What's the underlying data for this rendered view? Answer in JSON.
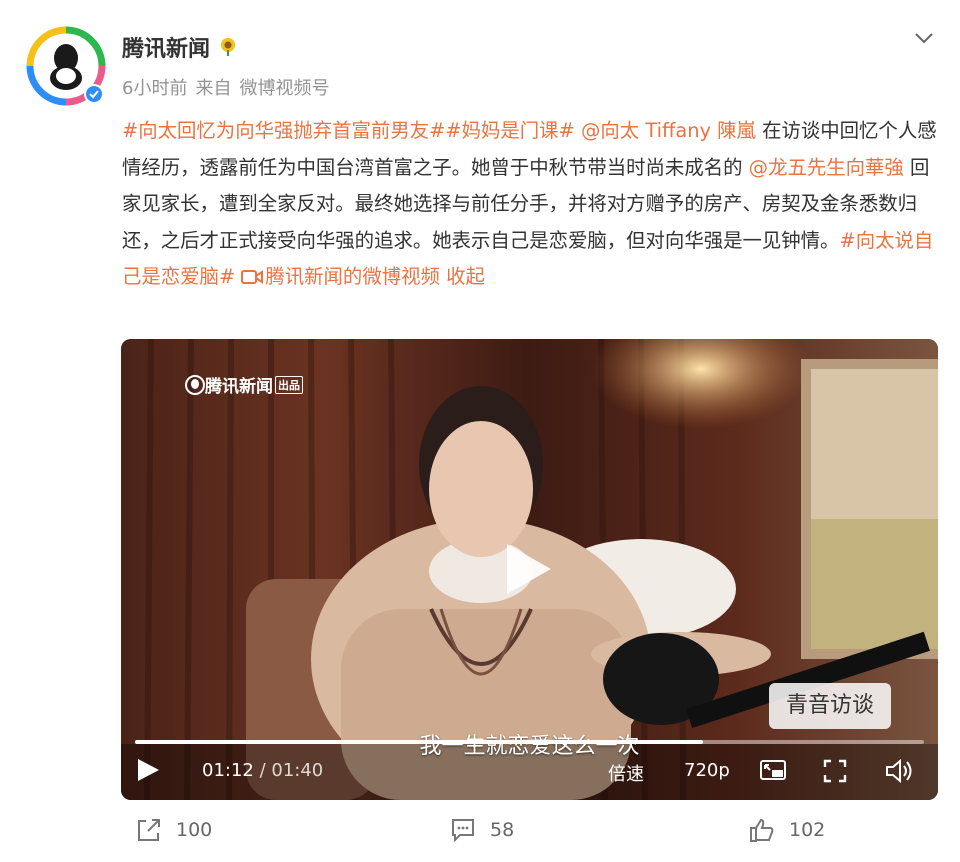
{
  "post": {
    "author": "腾讯新闻",
    "time": "6小时前",
    "source_prefix": "来自",
    "source": "微博视频号",
    "content": [
      {
        "type": "link",
        "text": "#向太回忆为向华强抛弃首富前男友#"
      },
      {
        "type": "link",
        "text": "#妈妈是门课#"
      },
      {
        "type": "text",
        "text": " "
      },
      {
        "type": "link",
        "text": "@向太 Tiffany 陳嵐"
      },
      {
        "type": "text",
        "text": " 在访谈中回忆个人感情经历，透露前任为中国台湾首富之子。她曾于中秋节带当时尚未成名的 "
      },
      {
        "type": "link",
        "text": "@龙五先生向華強"
      },
      {
        "type": "text",
        "text": " 回家见家长，遭到全家反对。最终她选择与前任分手，并将对方赠予的房产、房契及金条悉数归还，之后才正式接受向华强的追求。她表示自己是恋爱脑，但对向华强是一见钟情。"
      },
      {
        "type": "link",
        "text": "#向太说自己是恋爱脑#"
      },
      {
        "type": "text",
        "text": " "
      },
      {
        "type": "video-link",
        "text": "腾讯新闻的微博视频",
        "icon": "video-camera-icon"
      },
      {
        "type": "text",
        "text": " "
      },
      {
        "type": "link",
        "text": "收起"
      }
    ]
  },
  "video": {
    "watermark": "腾讯新闻",
    "watermark_badge": "出品",
    "show_name": "青音访谈",
    "subtitle": "我一生就恋爱这么一次",
    "current_time": "01:12",
    "separator": " / ",
    "duration": "01:40",
    "progress": 0.72,
    "speed_label": "倍速",
    "quality_label": "720p"
  },
  "actions": {
    "repost_count": "100",
    "comment_count": "58",
    "like_count": "102"
  },
  "colors": {
    "accent": "#eb7340",
    "verified": "#2f8ef5",
    "text": "#333333",
    "meta": "#939393"
  }
}
